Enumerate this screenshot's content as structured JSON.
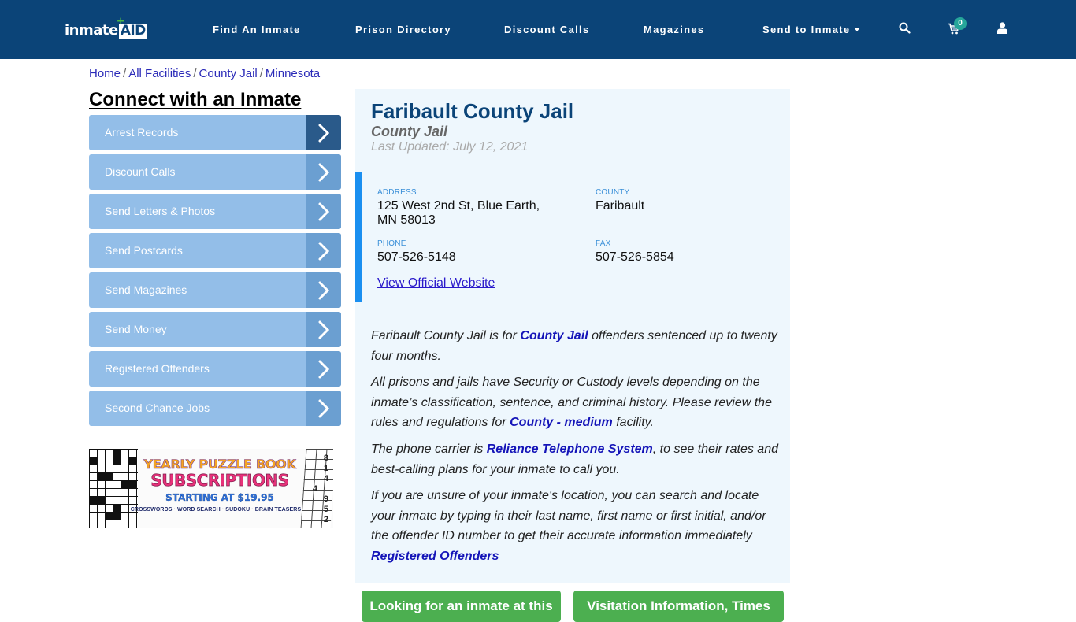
{
  "header": {
    "logo": {
      "text_main": "inmate",
      "text_accent": "AID",
      "plus": "+"
    },
    "nav": [
      {
        "label": "Find An Inmate"
      },
      {
        "label": "Prison Directory"
      },
      {
        "label": "Discount Calls"
      },
      {
        "label": "Magazines"
      },
      {
        "label": "Send to Inmate",
        "has_dropdown": true
      }
    ],
    "icons": {
      "search": "search-icon",
      "cart": "shopping-cart-icon",
      "user": "user-icon"
    },
    "cart_count": "0",
    "colors": {
      "bar": "#0b4478",
      "badge": "#26a69a"
    }
  },
  "breadcrumb": [
    {
      "label": "Home"
    },
    {
      "label": "All Facilities"
    },
    {
      "label": "County Jail"
    },
    {
      "label": "Minnesota"
    }
  ],
  "breadcrumb_separator": "/",
  "sidebar": {
    "title": "Connect with an Inmate",
    "items": [
      {
        "label": "Arrest Records",
        "active": true
      },
      {
        "label": "Discount Calls"
      },
      {
        "label": "Send Letters & Photos"
      },
      {
        "label": "Send Postcards"
      },
      {
        "label": "Send Magazines"
      },
      {
        "label": "Send Money"
      },
      {
        "label": "Registered Offenders"
      },
      {
        "label": "Second Chance Jobs"
      }
    ],
    "ad": {
      "line1": "YEARLY PUZZLE BOOK",
      "line2": "SUBSCRIPTIONS",
      "line3": "STARTING AT $19.95",
      "line4": "CROSSWORDS · WORD SEARCH · SUDOKU · BRAIN TEASERS",
      "sudoku_numbers": [
        "8",
        "1",
        "4",
        "4",
        "9",
        "5",
        "2"
      ]
    }
  },
  "facility": {
    "name": "Faribault County Jail",
    "type": "County Jail",
    "last_updated": "Last Updated: July 12, 2021",
    "address_label": "ADDRESS",
    "address_line1": "125 West 2nd St, Blue Earth,",
    "address_line2": "MN 58013",
    "county_label": "COUNTY",
    "county": "Faribault",
    "phone_label": "PHONE",
    "phone": "507-526-5148",
    "fax_label": "FAX",
    "fax": "507-526-5854",
    "website_link": "View Official Website"
  },
  "description": {
    "p1": {
      "pre": "Faribault County Jail is for ",
      "link": "County Jail",
      "post": " offenders sentenced up to twenty four months."
    },
    "p2": {
      "pre": "All prisons and jails have Security or Custody levels depending on the inmate’s classification, sentence, and criminal history. Please review the rules and regulations for ",
      "link": "County - medium",
      "post": " facility."
    },
    "p3": {
      "pre": "The phone carrier is ",
      "link": "Reliance Telephone System",
      "post": ", to see their rates and best-calling plans for your inmate to call you."
    },
    "p4": {
      "pre": "If you are unsure of your inmate's location, you can search and locate your inmate by typing in their last name, first name or first initial, and/or the offender ID number to get their accurate information immediately ",
      "link": "Registered Offenders"
    }
  },
  "buttons": {
    "looking_for_inmate": "Looking for an inmate at this",
    "visitation_info": "Visitation Information, Times"
  }
}
